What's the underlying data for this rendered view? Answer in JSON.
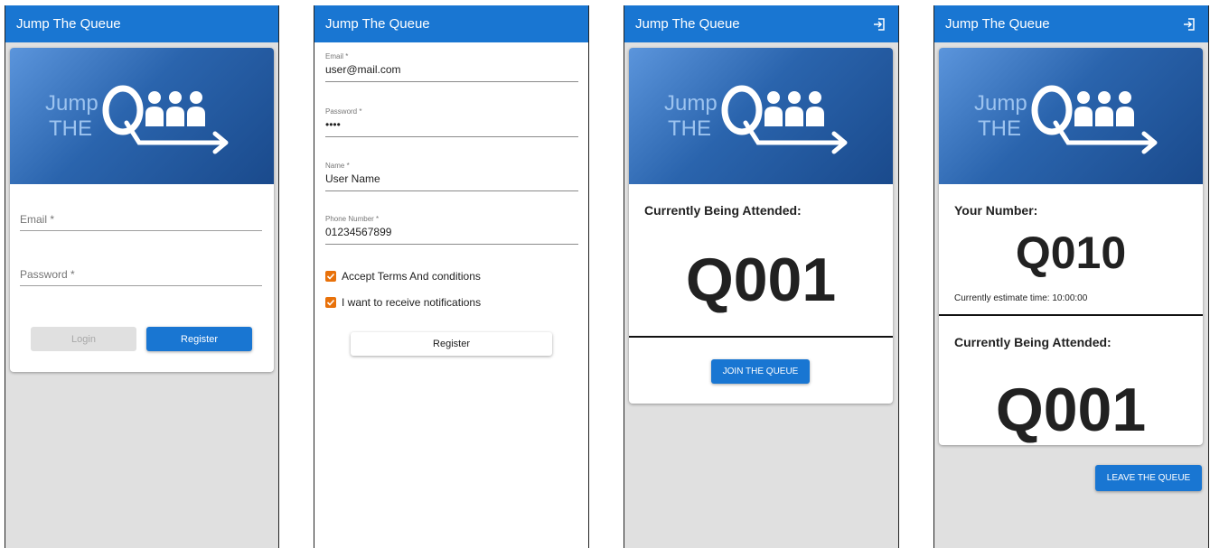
{
  "app_title": "Jump The Queue",
  "logo": {
    "jump": "Jump",
    "the": "THE"
  },
  "login": {
    "email_label": "Email *",
    "password_label": "Password *",
    "login_button": "Login",
    "register_button": "Register"
  },
  "register": {
    "email_label": "Email *",
    "email_value": "user@mail.com",
    "password_label": "Password *",
    "password_value": "••••",
    "name_label": "Name *",
    "name_value": "User Name",
    "phone_label": "Phone Number *",
    "phone_value": "01234567899",
    "terms_label": "Accept Terms And conditions",
    "terms_checked": true,
    "notifications_label": "I want to receive notifications",
    "notifications_checked": true,
    "register_button": "Register"
  },
  "queue": {
    "attended_label": "Currently Being Attended:",
    "attended_number": "Q001",
    "join_button": "JOIN THE QUEUE"
  },
  "ticket": {
    "your_number_label": "Your Number:",
    "your_number": "Q010",
    "estimate_text": "Currently estimate time: 10:00:00",
    "attended_label": "Currently Being Attended:",
    "attended_number": "Q001",
    "leave_button": "LEAVE THE QUEUE"
  },
  "colors": {
    "toolbar": "#1976d2",
    "checkbox": "#e8710a",
    "background": "#e0e0e0"
  },
  "icons": [
    "logout-icon",
    "checkmark-icon",
    "jump-the-queue-logo"
  ]
}
